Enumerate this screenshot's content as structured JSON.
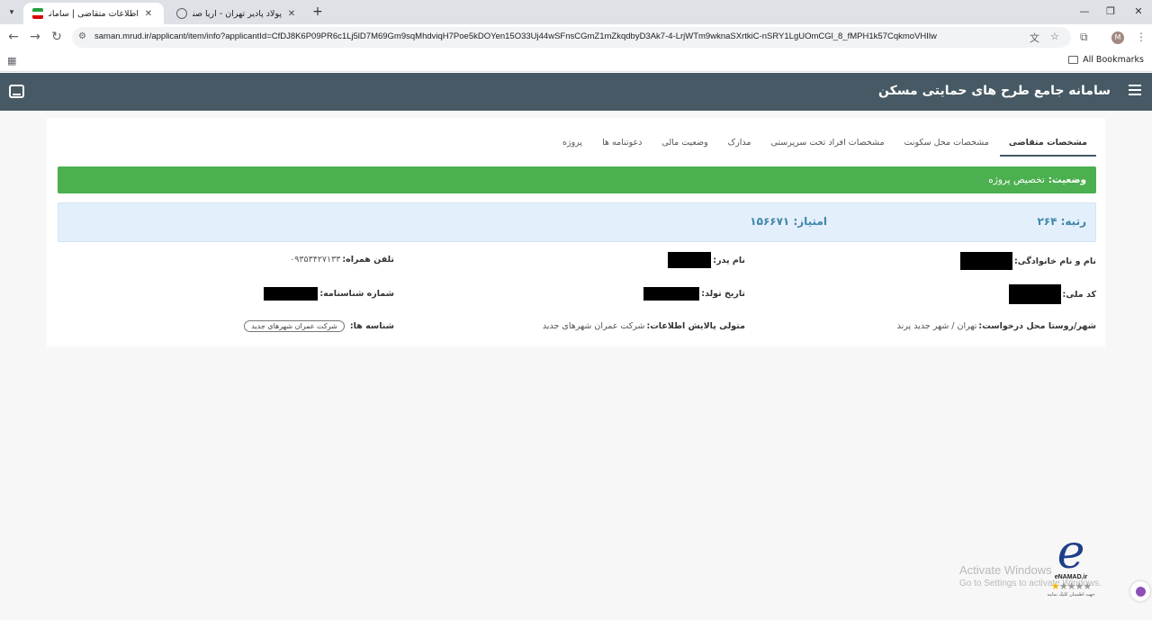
{
  "browser": {
    "tabs": [
      {
        "title": "اطلاعات متقاضی | سامانه جامع ط",
        "active": true
      },
      {
        "title": "پولاد پادیر تهران - آریا صنعت",
        "active": false
      }
    ],
    "url": "saman.mrud.ir/applicant/item/info?applicantId=CfDJ8K6P09PR6c1Lj5lD7M69Gm9sqMhdviqH7Poe5kDOYen15O33Uj44wSFnsCGmZ1mZkqdbyD3Ak7-4-LrjWTm9wknaSXrtkiC-nSRY1LgUOmCGl_8_fMPH1k57CqkmoVHIlw",
    "bookmarks_label": "All Bookmarks",
    "profile_initial": "M"
  },
  "app": {
    "title": "سامانه جامع طرح های حمایتی مسکن"
  },
  "tabs": [
    {
      "label": "مشخصات متقاضی",
      "active": true
    },
    {
      "label": "مشخصات محل سکونت",
      "active": false
    },
    {
      "label": "مشخصات افراد تحت سرپرستی",
      "active": false
    },
    {
      "label": "مدارک",
      "active": false
    },
    {
      "label": "وضعیت مالی",
      "active": false
    },
    {
      "label": "دعوتنامه ها",
      "active": false
    },
    {
      "label": "پروژه",
      "active": false
    }
  ],
  "status": {
    "label": "وضعیت:",
    "value": "تخصیص پروژه",
    "color": "#4caf50"
  },
  "ranking": {
    "rank_label": "رتبه:",
    "rank_value": "۲۶۴",
    "score_label": "امتیاز:",
    "score_value": "۱۵۶۶۷۱"
  },
  "fields": {
    "full_name": {
      "label": "نام و نام خانوادگی:"
    },
    "father_name": {
      "label": "نام پدر:"
    },
    "mobile": {
      "label": "تلفن همراه:",
      "value": "۰۹۳۵۳۴۲۷۱۳۳"
    },
    "national_code": {
      "label": "کد ملی:"
    },
    "birth_date": {
      "label": "تاریخ تولد:"
    },
    "id_number": {
      "label": "شماره شناسنامه:"
    },
    "city": {
      "label": "شهر/روستا محل درخواست:",
      "value": "تهران / شهر جدید پرند"
    },
    "data_refiner": {
      "label": "متولی پالایش اطلاعات:",
      "value": "شرکت عمران شهرهای جدید"
    },
    "identifiers": {
      "label": "شناسه ها:",
      "chip": "شرکت عمران شهرهای جدید"
    }
  },
  "overlay": {
    "windows_line1": "Activate Windows",
    "windows_line2": "Go to Settings to activate Windows.",
    "enamad_name": "eNAMAD.ir",
    "enamad_sub": "جهت اطمینان کلیک نمایید"
  }
}
